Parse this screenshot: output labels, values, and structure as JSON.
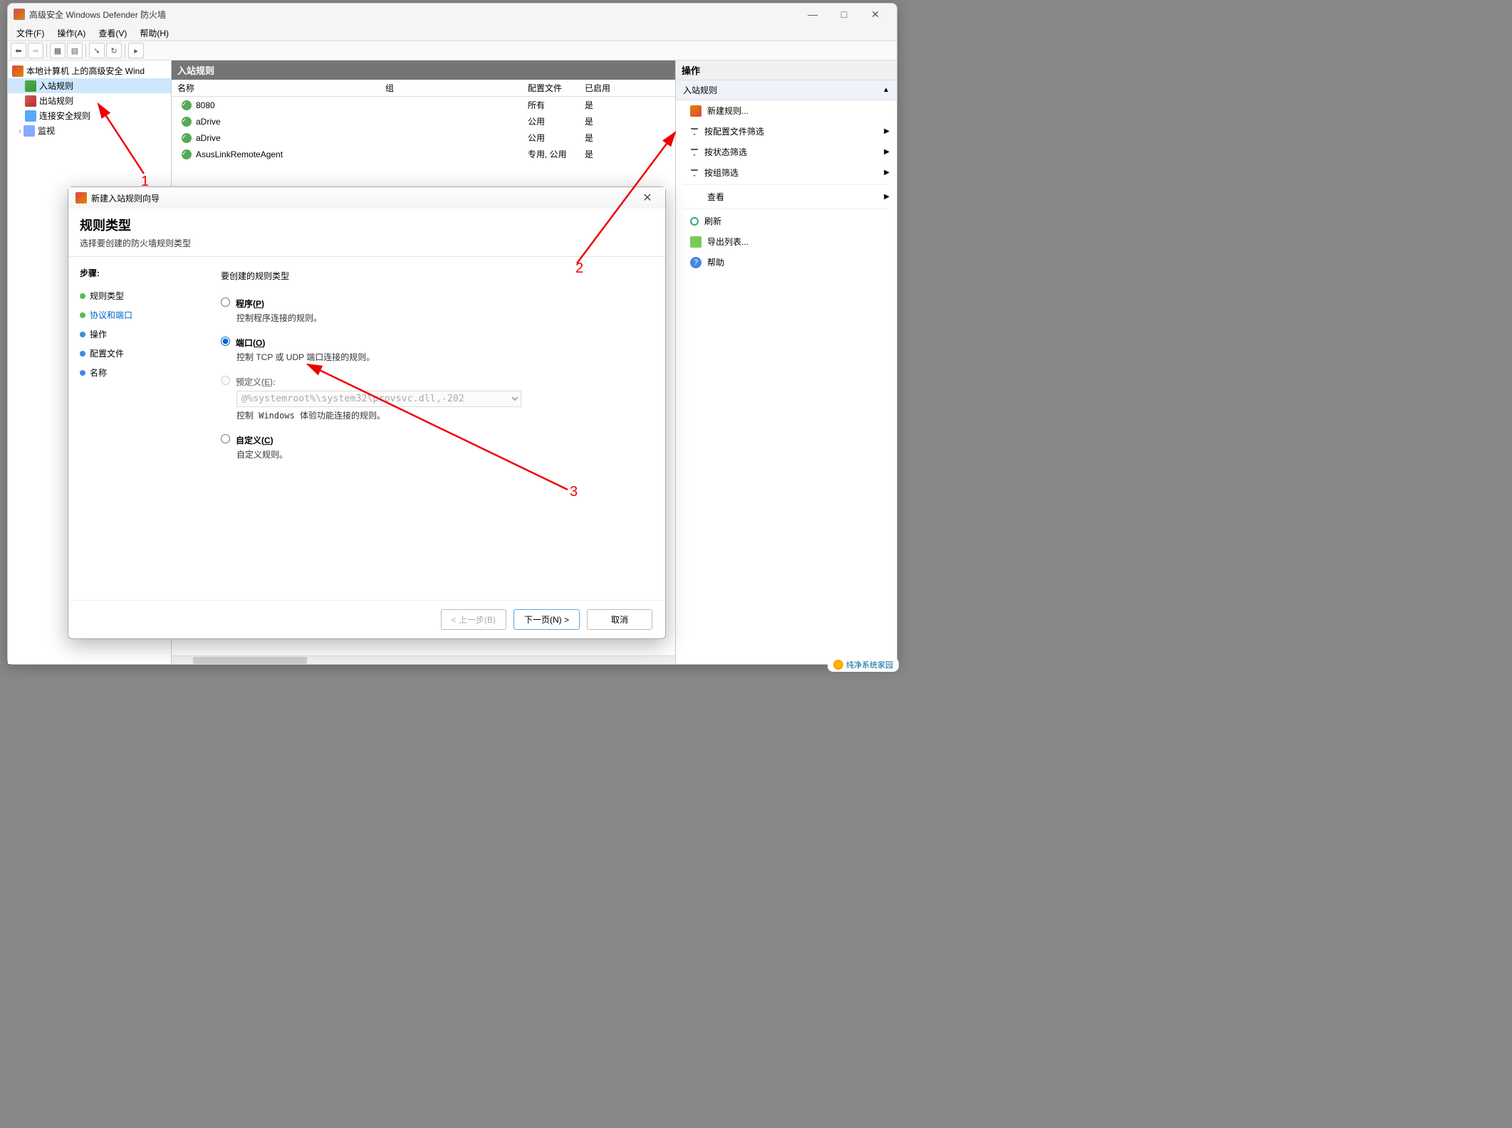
{
  "window": {
    "title": "高级安全 Windows Defender 防火墙",
    "minimize": "—",
    "maximize": "□",
    "close": "✕"
  },
  "menubar": {
    "file": "文件(F)",
    "action": "操作(A)",
    "view": "查看(V)",
    "help": "帮助(H)"
  },
  "tree": {
    "root": "本地计算机 上的高级安全 Wind",
    "inbound": "入站规则",
    "outbound": "出站规则",
    "connsec": "连接安全规则",
    "monitor": "监视"
  },
  "mid": {
    "header": "入站规则",
    "cols": {
      "name": "名称",
      "group": "组",
      "profile": "配置文件",
      "enabled": "已启用"
    },
    "rows": [
      {
        "name": "8080",
        "group": "",
        "profile": "所有",
        "enabled": "是"
      },
      {
        "name": "aDrive",
        "group": "",
        "profile": "公用",
        "enabled": "是"
      },
      {
        "name": "aDrive",
        "group": "",
        "profile": "公用",
        "enabled": "是"
      },
      {
        "name": "AsusLinkRemoteAgent",
        "group": "",
        "profile": "专用, 公用",
        "enabled": "是"
      }
    ]
  },
  "actions": {
    "header": "操作",
    "sub": "入站规则",
    "newrule": "新建规则...",
    "filterprofile": "按配置文件筛选",
    "filterstate": "按状态筛选",
    "filtergroup": "按组筛选",
    "view": "查看",
    "refresh": "刷新",
    "export": "导出列表...",
    "help": "帮助"
  },
  "wizard": {
    "title": "新建入站规则向导",
    "heading": "规则类型",
    "subheading": "选择要创建的防火墙规则类型",
    "steps_label": "步骤:",
    "step1": "规则类型",
    "step2": "协议和端口",
    "step3": "操作",
    "step4": "配置文件",
    "step5": "名称",
    "question": "要创建的规则类型",
    "opt_program": "程序(P)",
    "opt_program_desc": "控制程序连接的规则。",
    "opt_port": "端口(O)",
    "opt_port_desc": "控制 TCP 或 UDP 端口连接的规则。",
    "opt_predef": "预定义(E):",
    "opt_predef_sel": "@%systemroot%\\system32\\provsvc.dll,-202",
    "opt_predef_desc": "控制 Windows 体验功能连接的规则。",
    "opt_custom": "自定义(C)",
    "opt_custom_desc": "自定义规则。",
    "btn_back": "< 上一步(B)",
    "btn_next": "下一页(N) >",
    "btn_cancel": "取消"
  },
  "annotations": {
    "a1": "1",
    "a2": "2",
    "a3": "3"
  },
  "watermark": "纯净系统家园"
}
